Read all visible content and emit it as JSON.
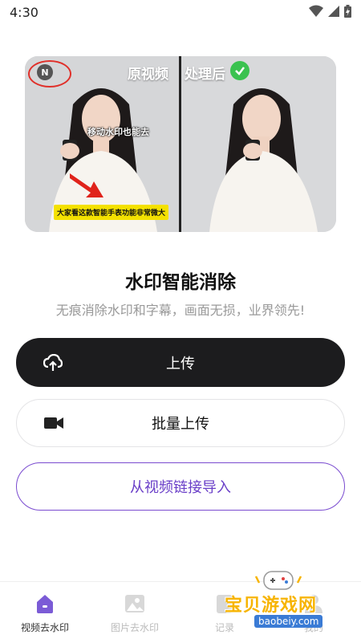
{
  "status_bar": {
    "time": "4:30"
  },
  "preview": {
    "label_before": "原视频",
    "label_after": "处理后",
    "watermark_overlay_text": "移动水印也能去",
    "caption_text": "大家看这款智能手表功能非常微大"
  },
  "main": {
    "title": "水印智能消除",
    "subtitle": "无痕消除水印和字幕，画面无损，业界领先!"
  },
  "buttons": {
    "upload": "上传",
    "batch_upload": "批量上传",
    "link_import": "从视频链接导入"
  },
  "bottom_nav": {
    "items": [
      {
        "label": "视频去水印",
        "icon": "home-icon",
        "active": true
      },
      {
        "label": "图片去水印",
        "icon": "image-icon",
        "active": false
      },
      {
        "label": "记录",
        "icon": "record-icon",
        "active": false
      },
      {
        "label": "我的",
        "icon": "profile-icon",
        "active": false
      }
    ]
  },
  "site_watermark": {
    "title": "宝贝游戏网",
    "url": "baobeiy.com"
  },
  "colors": {
    "accent_purple": "#6a3fc8",
    "primary_dark": "#1c1c1e",
    "nav_active": "#7b5bd6",
    "check_green": "#3ac24f"
  }
}
